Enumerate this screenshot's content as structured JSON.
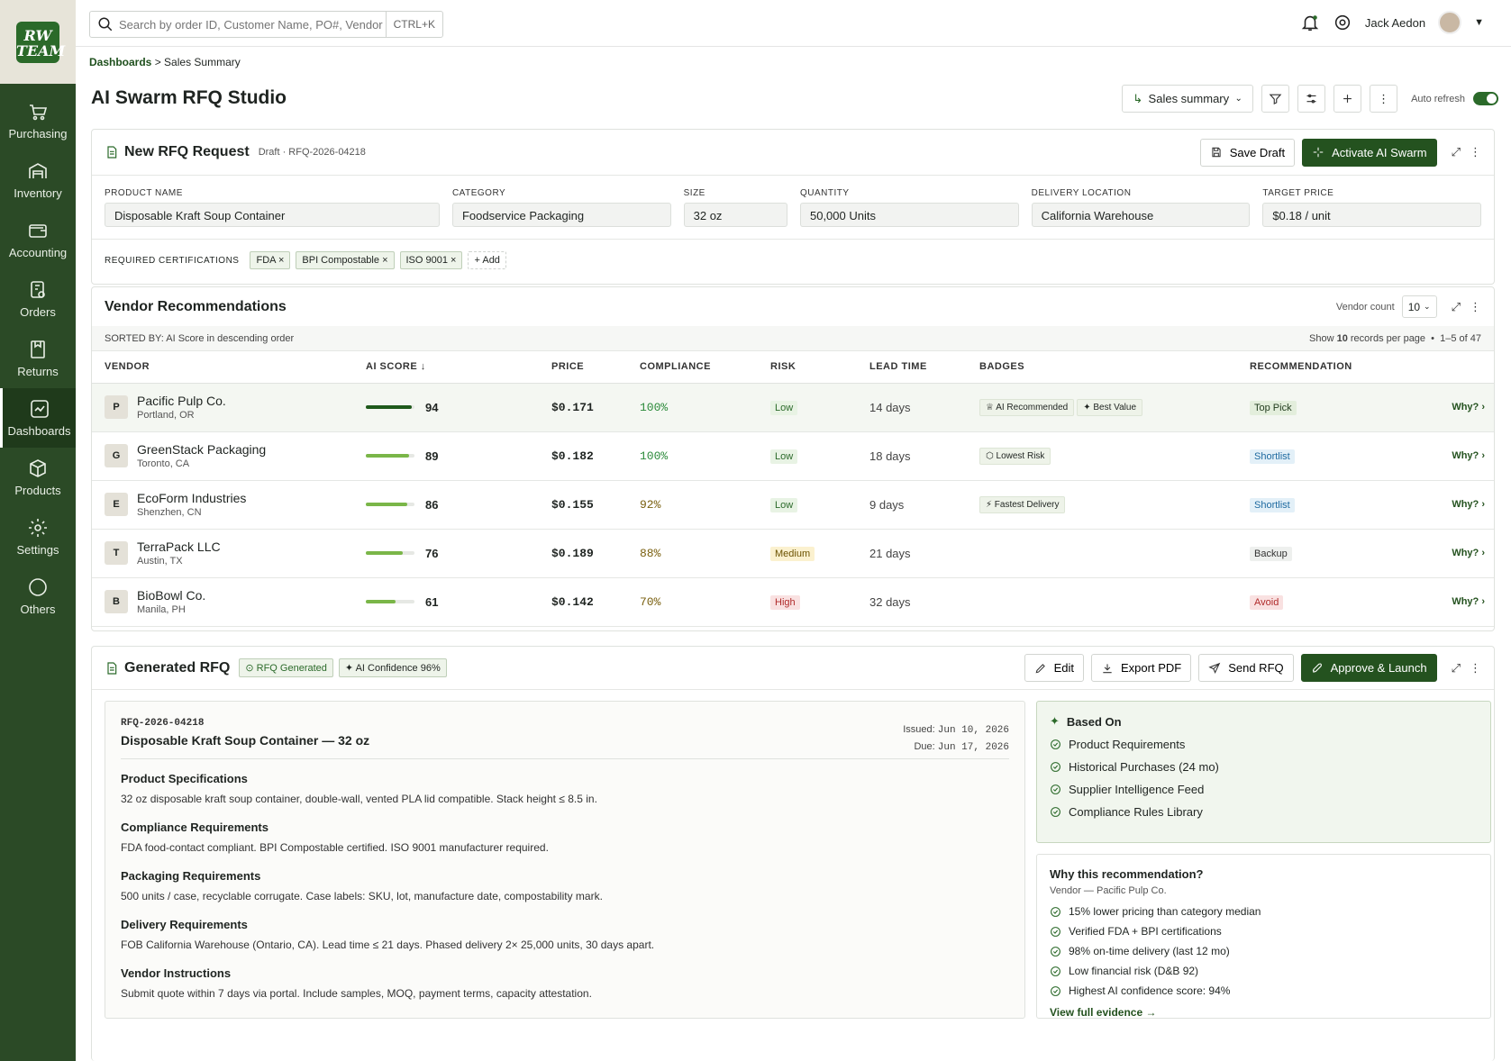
{
  "app": {
    "logo_line1": "RW",
    "logo_line2": "TEAM"
  },
  "sidebar": {
    "items": [
      {
        "label": "Purchasing",
        "icon": "cart-icon"
      },
      {
        "label": "Inventory",
        "icon": "warehouse-icon"
      },
      {
        "label": "Accounting",
        "icon": "wallet-icon"
      },
      {
        "label": "Orders",
        "icon": "orders-icon"
      },
      {
        "label": "Returns",
        "icon": "returns-icon"
      },
      {
        "label": "Dashboards",
        "icon": "dashboard-icon",
        "active": true
      },
      {
        "label": "Products",
        "icon": "box-icon"
      },
      {
        "label": "Settings",
        "icon": "gear-icon"
      },
      {
        "label": "Others",
        "icon": "more-circle-icon"
      }
    ]
  },
  "topbar": {
    "search_placeholder": "Search by order ID, Customer Name, PO#, Vendor",
    "shortcut": "CTRL+K",
    "user_name": "Jack Aedon"
  },
  "breadcrumb": {
    "parent": "Dashboards",
    "separator": " > ",
    "current": "Sales Summary"
  },
  "page": {
    "title": "AI Swarm RFQ Studio",
    "view_select": "Sales summary",
    "auto_refresh_label": "Auto refresh",
    "auto_refresh_on": true
  },
  "new_rfq": {
    "title": "New RFQ Request",
    "status": "Draft · RFQ-2026-04218",
    "save_label": "Save Draft",
    "activate_label": "Activate AI Swarm",
    "fields": [
      {
        "label": "PRODUCT NAME",
        "value": "Disposable Kraft Soup Container"
      },
      {
        "label": "CATEGORY",
        "value": "Foodservice Packaging"
      },
      {
        "label": "SIZE",
        "value": "32 oz"
      },
      {
        "label": "QUANTITY",
        "value": "50,000 Units"
      },
      {
        "label": "DELIVERY LOCATION",
        "value": "California Warehouse"
      },
      {
        "label": "TARGET PRICE",
        "value": "$0.18 / unit"
      }
    ],
    "cert_label": "REQUIRED CERTIFICATIONS",
    "certs": [
      "FDA",
      "BPI Compostable",
      "ISO 9001"
    ],
    "add_label": "+ Add"
  },
  "vendors": {
    "title": "Vendor Recommendations",
    "count_label": "Vendor count",
    "count_value": "10",
    "sorted_by": "SORTED BY: AI Score in descending order",
    "show_prefix": "Show ",
    "show_count": "10",
    "show_suffix": " records per page",
    "range": "1–5 of 47",
    "columns": [
      "VENDOR",
      "AI SCORE ↓",
      "PRICE",
      "COMPLIANCE",
      "RISK",
      "LEAD TIME",
      "BADGES",
      "RECOMMENDATION"
    ],
    "why_label": "Why? ›",
    "rows": [
      {
        "initial": "P",
        "name": "Pacific Pulp Co.",
        "location": "Portland, OR",
        "score": 94,
        "price": "$0.171",
        "compliance": "100%",
        "risk": "Low",
        "lead": "14 days",
        "badges": [
          "♕ AI Recommended",
          "✦ Best Value"
        ],
        "rec": "Top Pick"
      },
      {
        "initial": "G",
        "name": "GreenStack Packaging",
        "location": "Toronto, CA",
        "score": 89,
        "price": "$0.182",
        "compliance": "100%",
        "risk": "Low",
        "lead": "18 days",
        "badges": [
          "⬡ Lowest Risk"
        ],
        "rec": "Shortlist"
      },
      {
        "initial": "E",
        "name": "EcoForm Industries",
        "location": "Shenzhen, CN",
        "score": 86,
        "price": "$0.155",
        "compliance": "92%",
        "risk": "Low",
        "lead": "9 days",
        "badges": [
          "⚡ Fastest Delivery"
        ],
        "rec": "Shortlist"
      },
      {
        "initial": "T",
        "name": "TerraPack LLC",
        "location": "Austin, TX",
        "score": 76,
        "price": "$0.189",
        "compliance": "88%",
        "risk": "Medium",
        "lead": "21 days",
        "badges": [],
        "rec": "Backup"
      },
      {
        "initial": "B",
        "name": "BioBowl Co.",
        "location": "Manila, PH",
        "score": 61,
        "price": "$0.142",
        "compliance": "70%",
        "risk": "High",
        "lead": "32 days",
        "badges": [],
        "rec": "Avoid"
      }
    ]
  },
  "generated": {
    "title": "Generated RFQ",
    "status_badge": "RFQ Generated",
    "confidence_badge": "AI Confidence 96%",
    "edit_label": "Edit",
    "export_label": "Export PDF",
    "send_label": "Send RFQ",
    "approve_label": "Approve & Launch",
    "doc": {
      "id": "RFQ-2026-04218",
      "title": "Disposable Kraft Soup Container — 32 oz",
      "issued_label": "Issued: ",
      "issued": "Jun 10, 2026",
      "due_label": "Due: ",
      "due": "Jun 17, 2026",
      "sections": [
        {
          "h": "Product Specifications",
          "p": "32 oz disposable kraft soup container, double-wall, vented PLA lid compatible. Stack height ≤ 8.5 in."
        },
        {
          "h": "Compliance Requirements",
          "p": "FDA food-contact compliant. BPI Compostable certified. ISO 9001 manufacturer required."
        },
        {
          "h": "Packaging Requirements",
          "p": "500 units / case, recyclable corrugate. Case labels: SKU, lot, manufacture date, compostability mark."
        },
        {
          "h": "Delivery Requirements",
          "p": "FOB California Warehouse (Ontario, CA). Lead time ≤ 21 days. Phased delivery 2× 25,000 units, 30 days apart."
        },
        {
          "h": "Vendor Instructions",
          "p": "Submit quote within 7 days via portal. Include samples, MOQ, payment terms, capacity attestation."
        }
      ]
    },
    "based_on": {
      "title": "Based On",
      "items": [
        "Product Requirements",
        "Historical Purchases (24 mo)",
        "Supplier Intelligence Feed",
        "Compliance Rules Library"
      ]
    },
    "why": {
      "title": "Why this recommendation?",
      "sub": "Vendor — Pacific Pulp Co.",
      "items": [
        "15% lower pricing than category median",
        "Verified FDA + BPI certifications",
        "98% on-time delivery (last 12 mo)",
        "Low financial risk (D&B 92)",
        "Highest AI confidence score: 94%"
      ],
      "link": "View full evidence →"
    }
  },
  "colors": {
    "accent": "#24521f",
    "sidebar": "#2b4a26"
  }
}
